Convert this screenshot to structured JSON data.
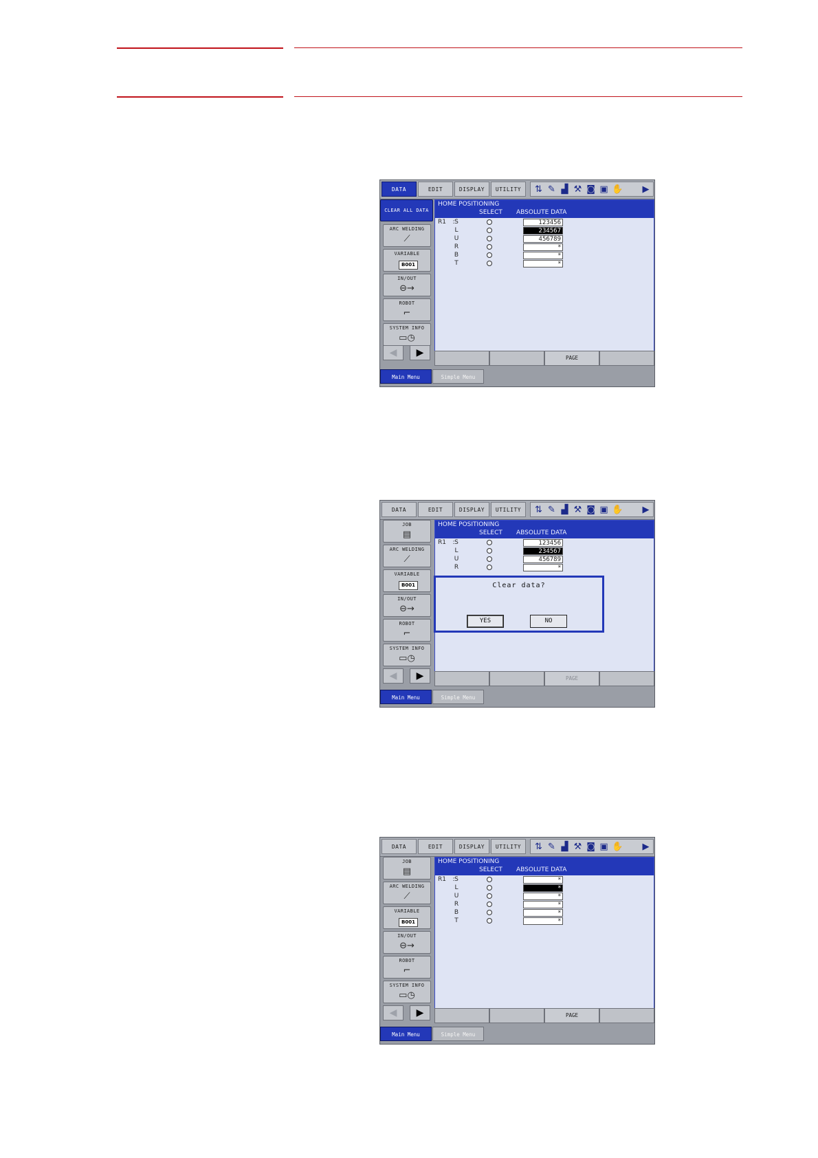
{
  "screens": [
    {
      "menu": {
        "tabs": [
          "DATA",
          "EDIT",
          "DISPLAY",
          "UTILITY"
        ],
        "active_tab": "DATA"
      },
      "sidebar": {
        "top_item": "CLEAR ALL DATA",
        "items": [
          "ARC WELDING",
          "VARIABLE",
          "IN/OUT",
          "ROBOT",
          "SYSTEM INFO"
        ],
        "variable_value": "B001"
      },
      "content": {
        "title": "HOME POSITIONING",
        "col_select": "SELECT",
        "col_absolute": "ABSOLUTE DATA",
        "group": "R1",
        "rows": [
          {
            "axis": "S",
            "value": "123456",
            "selected": false
          },
          {
            "axis": "L",
            "value": "234567",
            "selected": true
          },
          {
            "axis": "U",
            "value": "456789",
            "selected": false
          },
          {
            "axis": "R",
            "value": "*",
            "selected": false
          },
          {
            "axis": "B",
            "value": "*",
            "selected": false
          },
          {
            "axis": "T",
            "value": "*",
            "selected": false
          }
        ]
      },
      "bottom": {
        "page_label": "PAGE"
      },
      "footer": {
        "main_menu": "Main Menu",
        "simple_menu": "Simple Menu"
      }
    },
    {
      "menu": {
        "tabs": [
          "DATA",
          "EDIT",
          "DISPLAY",
          "UTILITY"
        ],
        "active_tab": ""
      },
      "sidebar": {
        "top_item": "JOB",
        "items": [
          "ARC WELDING",
          "VARIABLE",
          "IN/OUT",
          "ROBOT",
          "SYSTEM INFO"
        ],
        "variable_value": "B001"
      },
      "content": {
        "title": "HOME POSITIONING",
        "col_select": "SELECT",
        "col_absolute": "ABSOLUTE DATA",
        "group": "R1",
        "rows": [
          {
            "axis": "S",
            "value": "123456",
            "selected": false
          },
          {
            "axis": "L",
            "value": "234567",
            "selected": true
          },
          {
            "axis": "U",
            "value": "456789",
            "selected": false
          },
          {
            "axis": "R",
            "value": "*",
            "selected": false
          }
        ]
      },
      "dialog": {
        "message": "Clear data?",
        "yes": "YES",
        "no": "NO"
      },
      "bottom": {
        "page_label": "PAGE"
      },
      "footer": {
        "main_menu": "Main Menu",
        "simple_menu": "Simple Menu"
      }
    },
    {
      "menu": {
        "tabs": [
          "DATA",
          "EDIT",
          "DISPLAY",
          "UTILITY"
        ],
        "active_tab": ""
      },
      "sidebar": {
        "top_item": "JOB",
        "items": [
          "ARC WELDING",
          "VARIABLE",
          "IN/OUT",
          "ROBOT",
          "SYSTEM INFO"
        ],
        "variable_value": "B001"
      },
      "content": {
        "title": "HOME POSITIONING",
        "col_select": "SELECT",
        "col_absolute": "ABSOLUTE DATA",
        "group": "R1",
        "rows": [
          {
            "axis": "S",
            "value": "*",
            "selected": false
          },
          {
            "axis": "L",
            "value": "*",
            "selected": true
          },
          {
            "axis": "U",
            "value": "*",
            "selected": false
          },
          {
            "axis": "R",
            "value": "*",
            "selected": false
          },
          {
            "axis": "B",
            "value": "*",
            "selected": false
          },
          {
            "axis": "T",
            "value": "*",
            "selected": false
          }
        ]
      },
      "bottom": {
        "page_label": "PAGE"
      },
      "footer": {
        "main_menu": "Main Menu",
        "simple_menu": "Simple Menu"
      }
    }
  ],
  "icons": [
    "axis-order-icon",
    "edit-icon",
    "signal-icon",
    "tool-icon",
    "camera-icon",
    "monitor-icon",
    "hand-icon",
    "page-icon"
  ]
}
